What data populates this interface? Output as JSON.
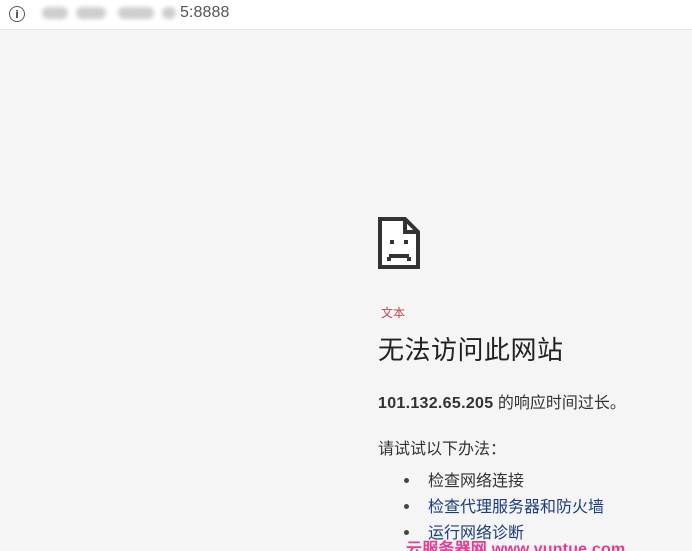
{
  "browser": {
    "url_visible": "5:8888",
    "info_icon": "info-icon"
  },
  "error_page": {
    "error_code": "文本",
    "title": "无法访问此网站",
    "message_ip": "101.132.65.205",
    "message_suffix": " 的响应时间过长。",
    "try_heading": "请试试以下办法：",
    "suggestions": [
      {
        "label": "检查网络连接"
      },
      {
        "label": "检查代理服务器和防火墙"
      },
      {
        "label": "运行网络诊断"
      }
    ]
  },
  "watermark": {
    "text": "云服务器网 www.yuntue.com"
  },
  "icons": {
    "sad_page": "sad-page-icon"
  },
  "colors": {
    "page_background": "#f5f5f5",
    "address_bar_background": "#ffffff",
    "error_code_red": "#b94a48",
    "watermark_pink": "#ea2f8a",
    "link_blue": "#1a3b87"
  }
}
